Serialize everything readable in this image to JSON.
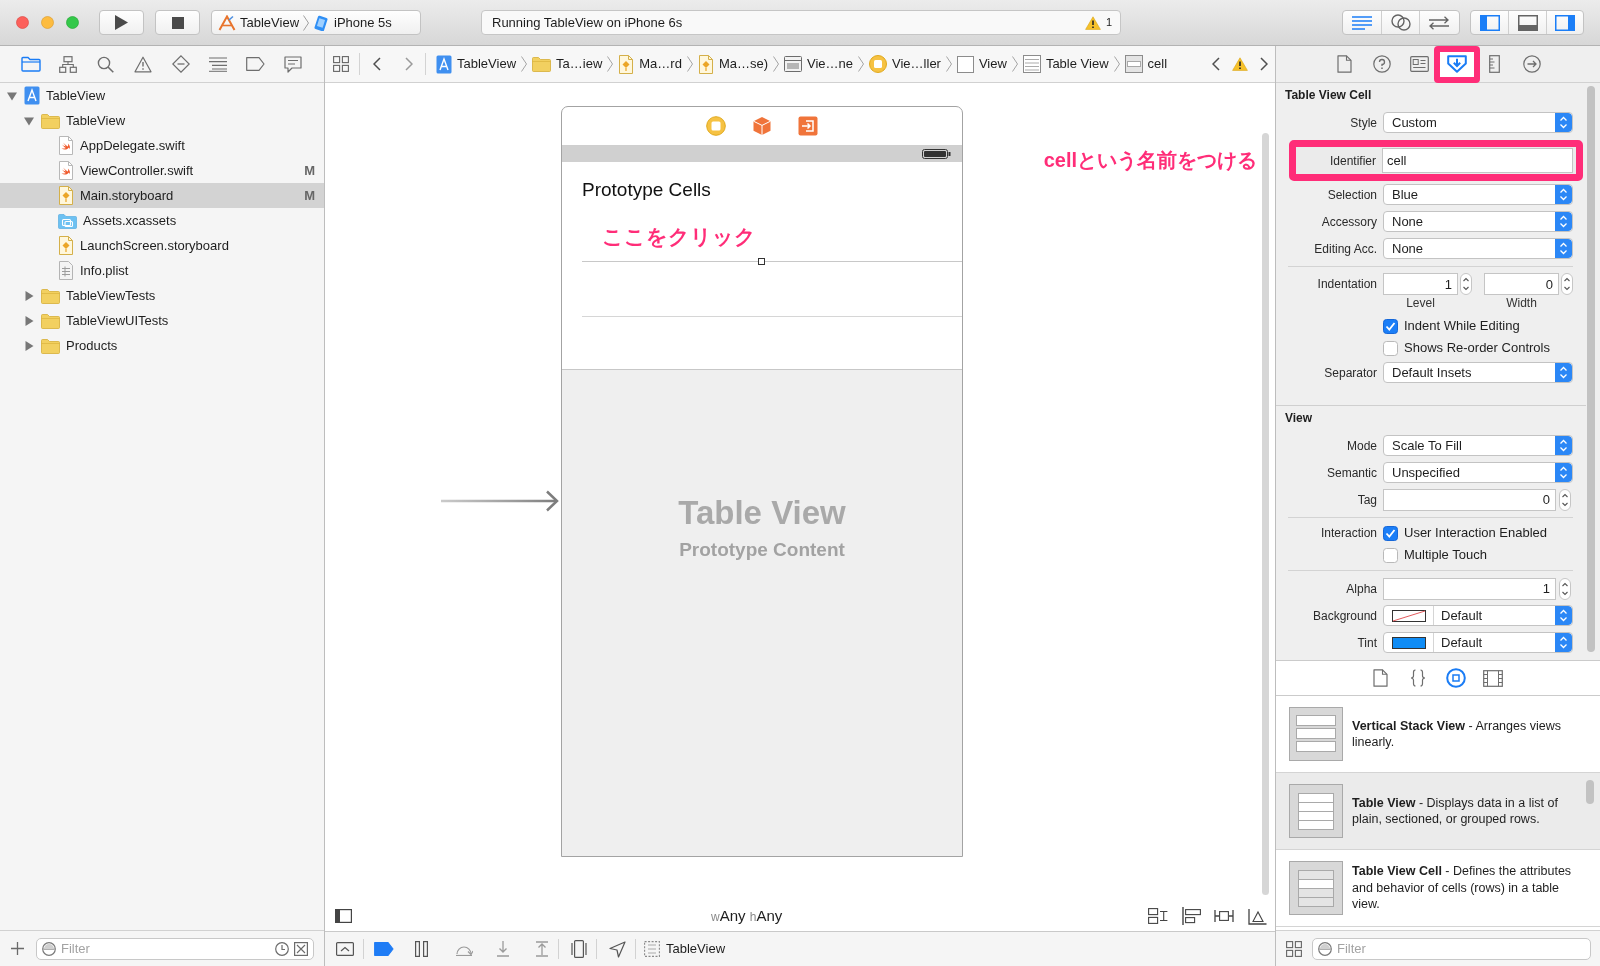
{
  "toolbar": {
    "scheme": {
      "target": "TableView",
      "destination": "iPhone 5s"
    },
    "activity": {
      "status": "Running TableView on iPhone 6s",
      "warnings": "1"
    },
    "editor_modes": [
      {
        "selected": true
      },
      {
        "selected": false
      },
      {
        "selected": false
      }
    ],
    "panel_toggles": [
      {
        "selected": true
      },
      {
        "selected": false
      },
      {
        "selected": true
      }
    ]
  },
  "navigator": {
    "tabs": [
      {
        "selected": true
      },
      {
        "selected": false
      },
      {
        "selected": false
      },
      {
        "selected": false
      },
      {
        "selected": false
      },
      {
        "selected": false
      },
      {
        "selected": false
      },
      {
        "selected": false
      }
    ],
    "tree": [
      {
        "name": "TableView",
        "kind": "project",
        "expanded": true,
        "selected": false,
        "children": [
          {
            "name": "TableView",
            "kind": "folder",
            "expanded": true,
            "selected": false,
            "children": [
              {
                "name": "AppDelegate.swift",
                "kind": "swift",
                "selected": false
              },
              {
                "name": "ViewController.swift",
                "kind": "swift",
                "status": "M",
                "selected": false
              },
              {
                "name": "Main.storyboard",
                "kind": "storyboard",
                "status": "M",
                "selected": true
              },
              {
                "name": "Assets.xcassets",
                "kind": "assets",
                "selected": false
              },
              {
                "name": "LaunchScreen.storyboard",
                "kind": "storyboard",
                "selected": false
              },
              {
                "name": "Info.plist",
                "kind": "plist",
                "selected": false
              }
            ]
          },
          {
            "name": "TableViewTests",
            "kind": "folder",
            "expanded": false,
            "selected": false
          },
          {
            "name": "TableViewUITests",
            "kind": "folder",
            "expanded": false,
            "selected": false
          },
          {
            "name": "Products",
            "kind": "folder",
            "expanded": false,
            "selected": false
          }
        ]
      }
    ],
    "filter": {
      "placeholder": "Filter"
    }
  },
  "jump_bar": {
    "path": [
      {
        "label": "TableView",
        "kind": "project"
      },
      {
        "label": "Ta…iew",
        "kind": "folder"
      },
      {
        "label": "Ma…rd",
        "kind": "storyboard"
      },
      {
        "label": "Ma…se)",
        "kind": "storyboard"
      },
      {
        "label": "Vie…ne",
        "kind": "scene"
      },
      {
        "label": "Vie…ller",
        "kind": "controller"
      },
      {
        "label": "View",
        "kind": "view"
      },
      {
        "label": "Table View",
        "kind": "table"
      },
      {
        "label": "cell",
        "kind": "cell"
      }
    ]
  },
  "canvas": {
    "annotation": "cellという名前をつける",
    "scene": {
      "section_title": "Prototype Cells",
      "cells": [
        {
          "selected": true,
          "annotation": "ここをクリック"
        }
      ],
      "empty_state": {
        "title": "Table View",
        "subtitle": "Prototype Content"
      }
    },
    "size_class": [
      {
        "prefix": "w",
        "value": "Any"
      },
      {
        "prefix": "h",
        "value": "Any"
      }
    ]
  },
  "debug_bar": {
    "breakpoints": {
      "on": true
    },
    "target": "TableView"
  },
  "inspector": {
    "tabs": [
      {
        "selected": false,
        "highlighted": false
      },
      {
        "selected": false,
        "highlighted": false
      },
      {
        "selected": false,
        "highlighted": false
      },
      {
        "selected": true,
        "highlighted": true
      },
      {
        "selected": false,
        "highlighted": false
      },
      {
        "selected": false,
        "highlighted": false
      }
    ],
    "sections": [
      {
        "title": "Table View Cell",
        "groups": [
          [
            {
              "kind": "popup",
              "label": "Style",
              "value": "Custom"
            },
            {
              "kind": "text",
              "label": "Identifier",
              "value": "cell",
              "highlighted": true
            },
            {
              "kind": "popup",
              "label": "Selection",
              "value": "Blue"
            },
            {
              "kind": "popup",
              "label": "Accessory",
              "value": "None"
            },
            {
              "kind": "popup",
              "label": "Editing Acc.",
              "value": "None"
            }
          ],
          [
            {
              "kind": "steppers",
              "label": "Indentation",
              "fields": [
                {
                  "value": "1",
                  "caption": "Level"
                },
                {
                  "value": "0",
                  "caption": "Width"
                }
              ]
            },
            {
              "kind": "checkbox",
              "text": "Indent While Editing",
              "checked": true
            },
            {
              "kind": "checkbox",
              "text": "Shows Re-order Controls",
              "checked": false
            },
            {
              "kind": "popup",
              "label": "Separator",
              "value": "Default Insets"
            }
          ]
        ]
      },
      {
        "title": "View",
        "groups": [
          [
            {
              "kind": "popup",
              "label": "Mode",
              "value": "Scale To Fill"
            },
            {
              "kind": "popup",
              "label": "Semantic",
              "value": "Unspecified"
            },
            {
              "kind": "stepper",
              "label": "Tag",
              "value": "0"
            }
          ],
          [
            {
              "kind": "checkbox",
              "label": "Interaction",
              "text": "User Interaction Enabled",
              "checked": true
            },
            {
              "kind": "checkbox",
              "text": "Multiple Touch",
              "checked": false
            }
          ],
          [
            {
              "kind": "stepper",
              "label": "Alpha",
              "value": "1"
            },
            {
              "kind": "color",
              "label": "Background",
              "swatch": {
                "kind": "clear"
              },
              "value": "Default"
            },
            {
              "kind": "color",
              "label": "Tint",
              "swatch": {
                "kind": "solid",
                "color": "#0f8cf5"
              },
              "value": "Default"
            }
          ]
        ]
      }
    ]
  },
  "library": {
    "tabs": [
      {
        "selected": false
      },
      {
        "selected": false
      },
      {
        "selected": true
      },
      {
        "selected": false
      }
    ],
    "items": [
      {
        "kind": "stack",
        "text": "**Vertical Stack View** - Arranges views linearly.",
        "selected": false
      },
      {
        "kind": "table",
        "text": "**Table View** - Displays data in a list of plain, sectioned, or grouped rows.",
        "selected": true
      },
      {
        "kind": "cell",
        "text": "**Table View Cell** - Defines the attributes and behavior of cells (rows) in a table view.",
        "selected": false
      }
    ],
    "filter": {
      "placeholder": "Filter"
    }
  }
}
